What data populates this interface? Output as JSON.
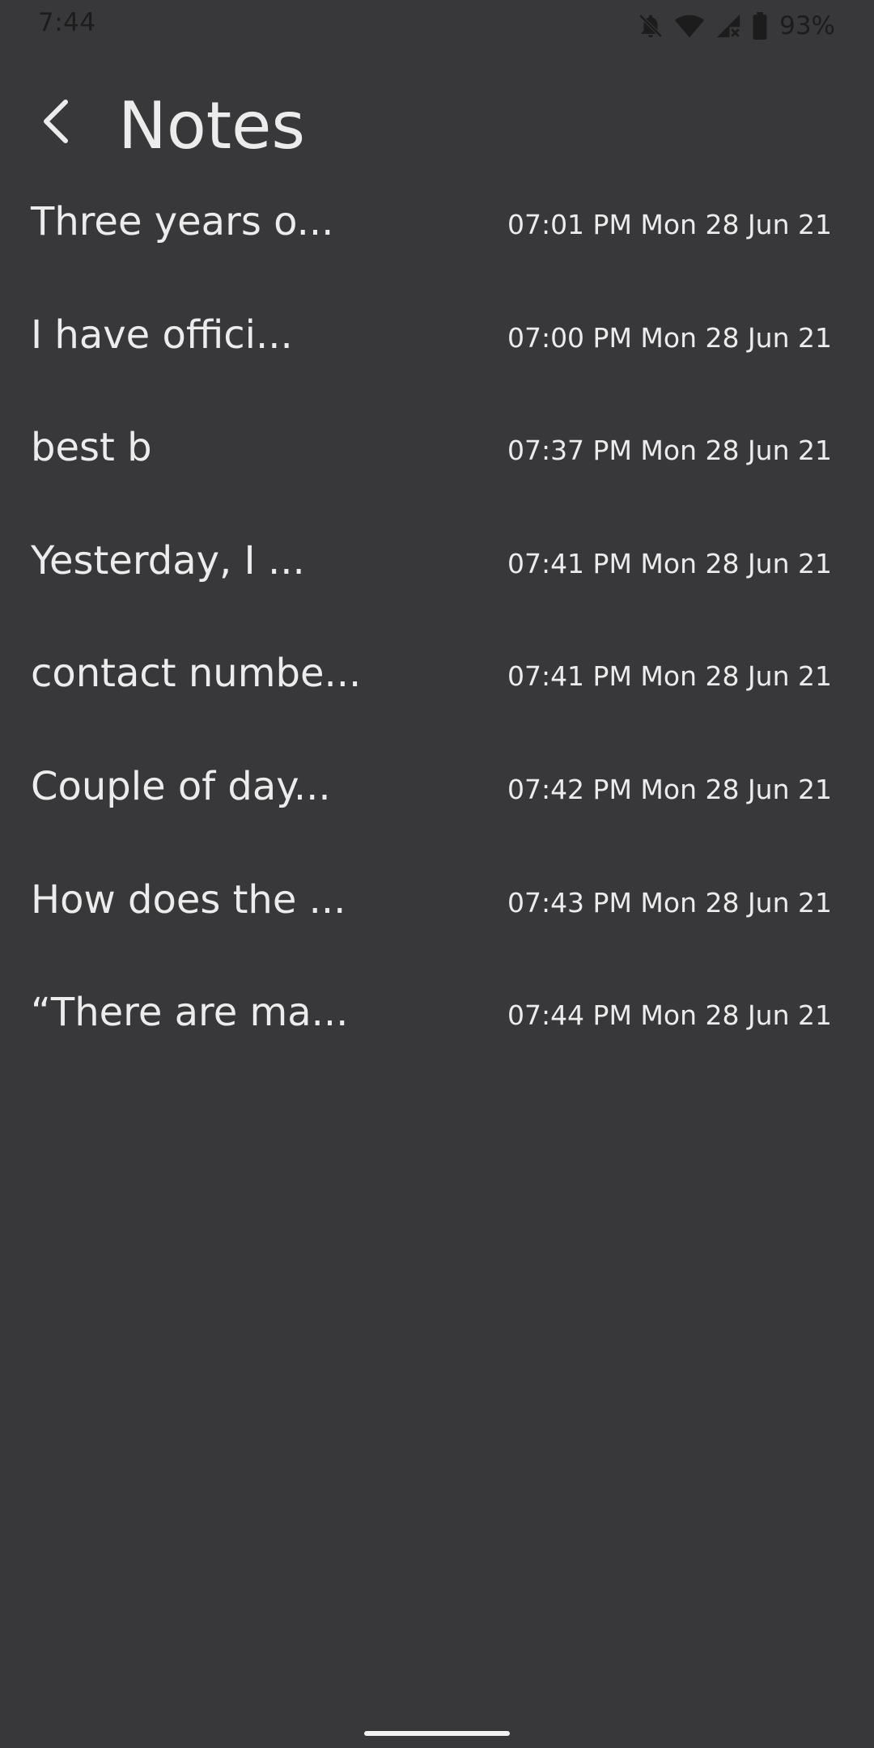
{
  "status_bar": {
    "time": "7:44",
    "battery": "93%",
    "icons": [
      "notifications-off-icon",
      "wifi-icon",
      "signal-no-data-icon",
      "battery-icon"
    ]
  },
  "app_bar": {
    "back_icon": "arrow-back-icon",
    "title": "Notes"
  },
  "notes": [
    {
      "title": "Three years o...",
      "date": "07:01 PM Mon 28 Jun 21"
    },
    {
      "title": "I have offici...",
      "date": "07:00 PM Mon 28 Jun 21"
    },
    {
      "title": "best b",
      "date": "07:37 PM Mon 28 Jun 21"
    },
    {
      "title": "Yesterday, I ...",
      "date": "07:41 PM Mon 28 Jun 21"
    },
    {
      "title": "contact numbe...",
      "date": "07:41 PM Mon 28 Jun 21"
    },
    {
      "title": "Couple of day...",
      "date": "07:42 PM Mon 28 Jun 21"
    },
    {
      "title": "How does the ...",
      "date": "07:43 PM Mon 28 Jun 21"
    },
    {
      "title": "“There are ma...",
      "date": "07:44 PM Mon 28 Jun 21"
    }
  ],
  "colors": {
    "background": "#38383a",
    "text": "#ececec",
    "status_icons": "#1c1c1c"
  }
}
